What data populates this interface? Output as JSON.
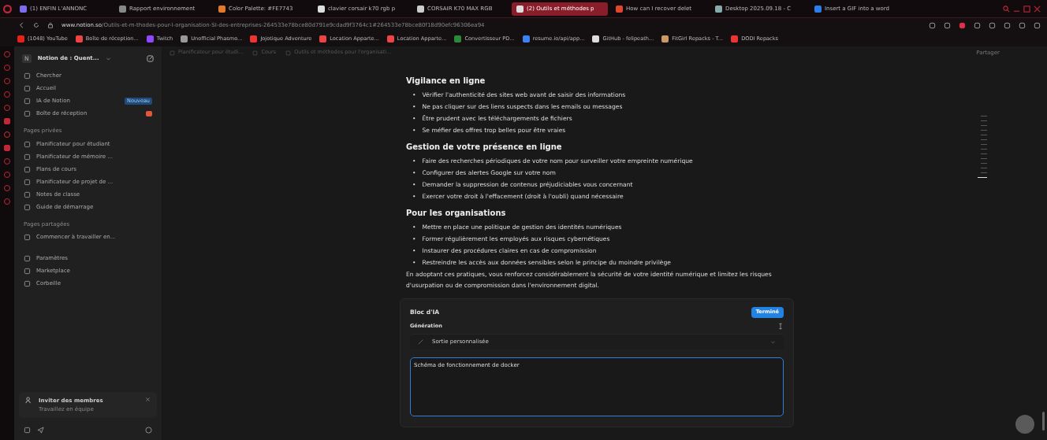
{
  "browser": {
    "tabs": [
      {
        "label": "(1) ENFIN L'ANNONC",
        "selected": false
      },
      {
        "label": "Rapport environnement",
        "selected": false
      },
      {
        "label": "Color Palette: #FE7743",
        "selected": false
      },
      {
        "label": "clavier corsair k70 rgb p",
        "selected": false
      },
      {
        "label": "CORSAIR K70 MAX RGB",
        "selected": false
      },
      {
        "label": "(2) Outils et méthodes p",
        "selected": true
      },
      {
        "label": "How can I recover delet",
        "selected": false
      },
      {
        "label": "Desktop 2025.09.18 - C",
        "selected": false
      },
      {
        "label": "Insert a GIF into a word",
        "selected": false
      }
    ],
    "url_host": "www.notion.so",
    "url_path": "/Outils-et-m-thodes-pour-l-organisation-SI-des-entreprises-264533e78bce80d791e9cdad9f3764c1#264533e78bce80f18d90efc96306ea94",
    "bookmarks": [
      "(1048) YouTube",
      "Boîte de réception...",
      "Twitch",
      "Unofficial Phasmo...",
      "Jojotique Adventure",
      "Location Apparte...",
      "Location Apparte...",
      "Convertisseur PD...",
      "resume.io/api/app...",
      "GitHub - felipeath...",
      "FitGirl Repacks - T...",
      "DODI Repacks"
    ]
  },
  "sidebar": {
    "workspace_icon": "N",
    "workspace": "Notion de : Quent...",
    "top_items": [
      {
        "label": "Chercher"
      },
      {
        "label": "Accueil"
      },
      {
        "label": "IA de Notion",
        "badge": "Nouveau"
      },
      {
        "label": "Boîte de réception",
        "unread": true
      }
    ],
    "sections": [
      {
        "title": "Pages privées",
        "items": [
          "Planificateur pour étudiant",
          "Planificateur de mémoire ...",
          "Plans de cours",
          "Planificateur de projet de ...",
          "Notes de classe",
          "Guide de démarrage"
        ]
      },
      {
        "title": "Pages partagées",
        "items": [
          "Commencer à travailler en..."
        ]
      }
    ],
    "bottom_items": [
      "Paramètres",
      "Marketplace",
      "Corbeille"
    ],
    "invite": {
      "title": "Inviter des membres",
      "subtitle": "Travaillez en équipe"
    }
  },
  "breadcrumb": [
    "Planificateur pour étudi...",
    "Cours",
    "Outils et méthodes pour l'organisati..."
  ],
  "share": "Partager",
  "content": [
    {
      "kind": "heading",
      "text": "Vigilance en ligne"
    },
    {
      "kind": "bullets",
      "marker": "•",
      "items": [
        "Vérifier l'authenticité des sites web avant de saisir des informations",
        "Ne pas cliquer sur des liens suspects dans les emails ou messages",
        "Être prudent avec les téléchargements de fichiers",
        "Se méfier des offres trop belles pour être vraies"
      ]
    },
    {
      "kind": "heading",
      "text": "Gestion de votre présence en ligne"
    },
    {
      "kind": "bullets",
      "marker": "•",
      "items": [
        "Faire des recherches périodiques de votre nom pour surveiller votre empreinte numérique",
        "Configurer des alertes Google sur votre nom",
        "Demander la suppression de contenus préjudiciables vous concernant",
        "Exercer votre droit à l'effacement (droit à l'oubli) quand nécessaire"
      ]
    },
    {
      "kind": "heading",
      "text": "Pour les organisations"
    },
    {
      "kind": "bullets",
      "marker": "•",
      "items": [
        "Mettre en place une politique de gestion des identités numériques",
        "Former régulièrement les employés aux risques cybernétiques",
        "Instaurer des procédures claires en cas de compromission",
        "Restreindre les accès aux données sensibles selon le principe du moindre privilège"
      ]
    },
    {
      "kind": "paragraph",
      "text": "En adoptant ces pratiques, vous renforcez considérablement la sécurité de votre identité numérique et limitez les risques d'usurpation ou de compromission dans l'environnement digital."
    }
  ],
  "ai_block": {
    "title": "Bloc d'IA",
    "done_button": "Terminé",
    "section": "Génération",
    "output": "Sortie personnalisée",
    "prompt": "Schéma de fonctionnement de docker"
  }
}
